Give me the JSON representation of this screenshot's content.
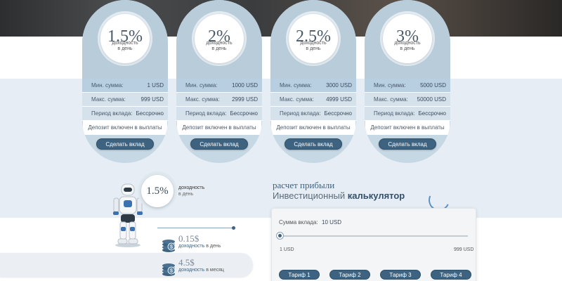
{
  "plans": [
    {
      "rate": "1.5%",
      "rate_line1": "доходность",
      "rate_line2": "в день",
      "min_label": "Мин. сумма:",
      "min_value": "1 USD",
      "max_label": "Макс. сумма:",
      "max_value": "999 USD",
      "period_label": "Период вклада:",
      "period_value": "Бессрочно",
      "note": "Депозит включен в выплаты",
      "button": "Сделать вклад"
    },
    {
      "rate": "2%",
      "rate_line1": "доходность",
      "rate_line2": "в день",
      "min_label": "Мин. сумма:",
      "min_value": "1000 USD",
      "max_label": "Макс. сумма:",
      "max_value": "2999 USD",
      "period_label": "Период вклада:",
      "period_value": "Бессрочно",
      "note": "Депозит включен в выплаты",
      "button": "Сделать вклад"
    },
    {
      "rate": "2.5%",
      "rate_line1": "доходность",
      "rate_line2": "в день",
      "min_label": "Мин. сумма:",
      "min_value": "3000 USD",
      "max_label": "Макс. сумма:",
      "max_value": "4999 USD",
      "period_label": "Период вклада:",
      "period_value": "Бессрочно",
      "note": "Депозит включен в выплаты",
      "button": "Сделать вклад"
    },
    {
      "rate": "3%",
      "rate_line1": "доходность",
      "rate_line2": "в день",
      "min_label": "Мин. сумма:",
      "min_value": "5000 USD",
      "max_label": "Макс. сумма:",
      "max_value": "50000 USD",
      "period_label": "Период вклада:",
      "period_value": "Бессрочно",
      "note": "Депозит включен в выплаты",
      "button": "Сделать вклад"
    }
  ],
  "result": {
    "rate": "1.5%",
    "rate_line1": "доходность",
    "rate_line2": "в день",
    "daily_value": "0.15$",
    "daily_prefix": "доходность",
    "daily_suffix": "в день",
    "monthly_value": "4.5$",
    "monthly_prefix": "доходность",
    "monthly_suffix": "в месяц"
  },
  "calculator": {
    "subtitle": "расчет прибыли",
    "title_plain": "Инвестиционный",
    "title_bold": "калькулятор",
    "sum_label": "Сумма вклада:",
    "sum_value": "10 USD",
    "slider_fraction": 0.0,
    "min_label": "1 USD",
    "max_label": "999 USD",
    "tariffs": [
      "Тариф 1",
      "Тариф 2",
      "Тариф 3",
      "Тариф 4"
    ]
  },
  "icons": [
    "robot-image",
    "coins-icon",
    "spinner-icon"
  ],
  "colors": {
    "accent": "#3d6380",
    "band": "#e6edf4",
    "plan_bg": "#c7d8e5"
  }
}
